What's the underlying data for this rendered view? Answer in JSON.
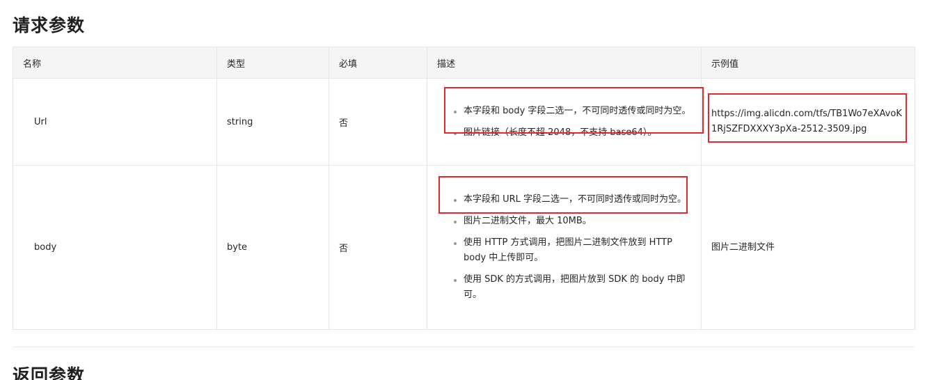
{
  "request_section": {
    "title": "请求参数"
  },
  "table": {
    "headers": {
      "name": "名称",
      "type": "类型",
      "required": "必填",
      "description": "描述",
      "example": "示例值"
    },
    "rows": [
      {
        "name": "Url",
        "type": "string",
        "required": "否",
        "description": [
          "本字段和 body 字段二选一，不可同时透传或同时为空。",
          "图片链接（长度不超 2048，不支持 base64）。"
        ],
        "example": "https://img.alicdn.com/tfs/TB1Wo7eXAvoK1RjSZFDXXXY3pXa-2512-3509.jpg"
      },
      {
        "name": "body",
        "type": "byte",
        "required": "否",
        "description": [
          "本字段和 URL 字段二选一，不可同时透传或同时为空。",
          "图片二进制文件，最大 10MB。",
          "使用 HTTP 方式调用，把图片二进制文件放到 HTTP body 中上传即可。",
          "使用 SDK 的方式调用，把图片放到 SDK 的 body 中即可。"
        ],
        "example": "图片二进制文件"
      }
    ]
  },
  "response_section": {
    "title": "返回参数"
  },
  "highlight_color": "#e8252a"
}
